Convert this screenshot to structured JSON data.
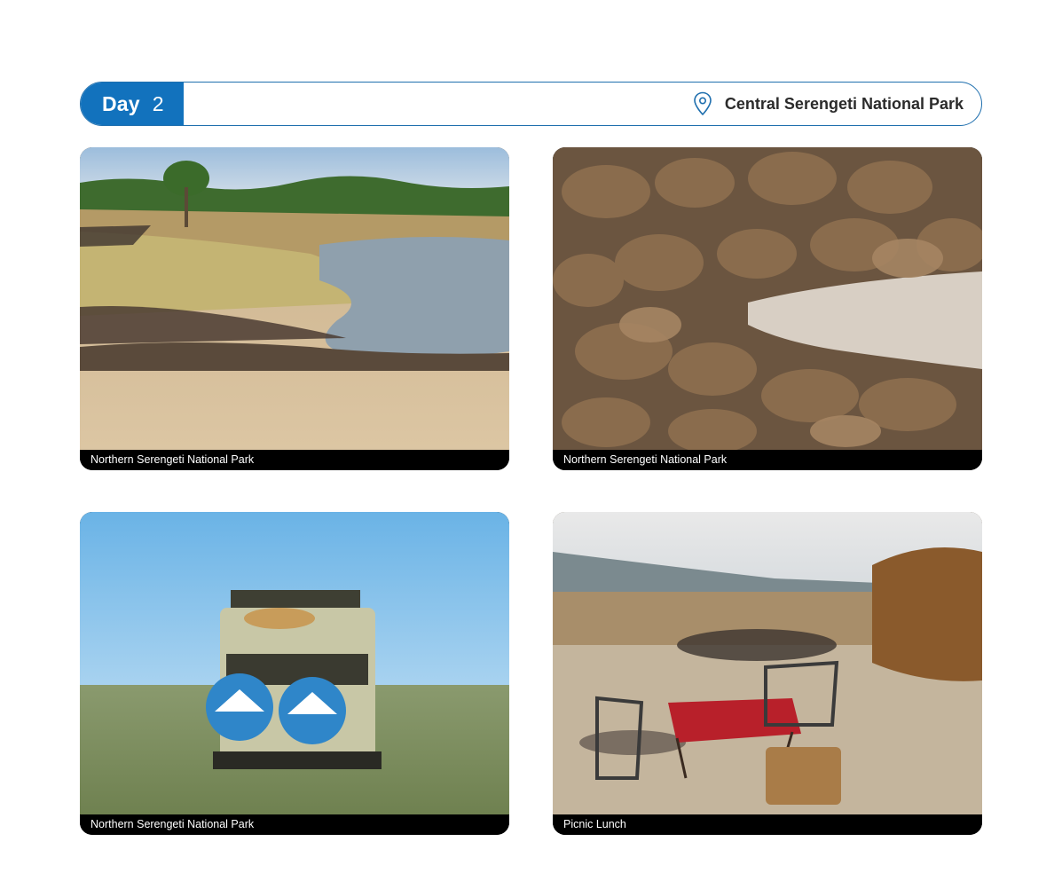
{
  "header": {
    "day_label": "Day",
    "day_number": "2",
    "location_icon": "location-pin-icon",
    "location": "Central Serengeti National Park",
    "accent_color": "#1272bd"
  },
  "photos": [
    {
      "caption": "Northern Serengeti National Park",
      "subject": "river-crossing-landscape"
    },
    {
      "caption": "Northern Serengeti National Park",
      "subject": "wildebeest-herd-closeup"
    },
    {
      "caption": "Northern Serengeti National Park",
      "subject": "cheetah-on-safari-vehicle"
    },
    {
      "caption": "Picnic Lunch",
      "subject": "picnic-table-in-crater"
    }
  ]
}
